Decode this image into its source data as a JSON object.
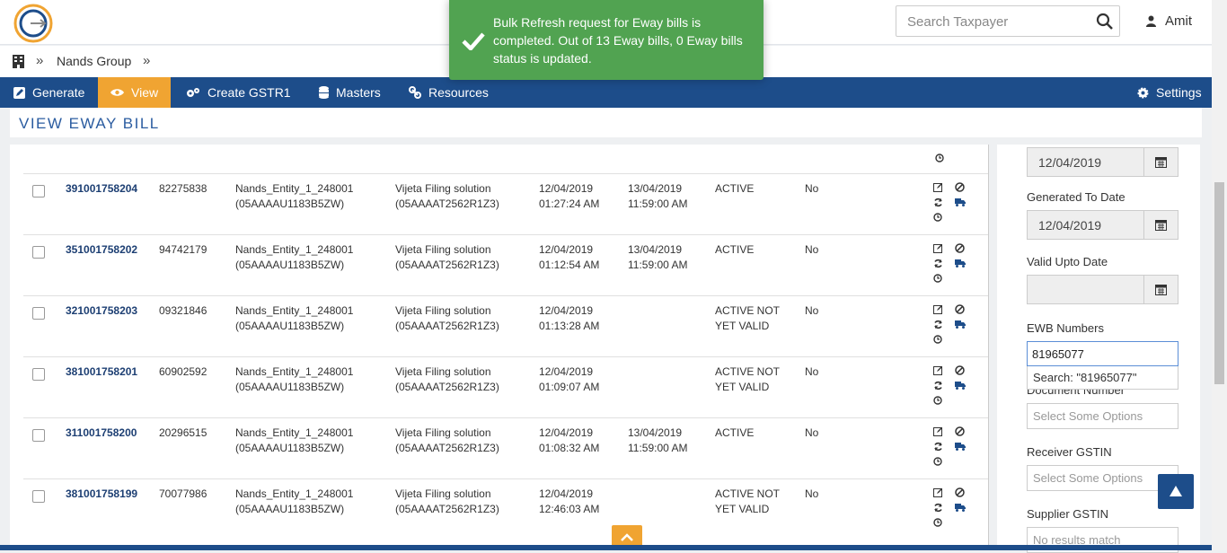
{
  "header": {
    "search_placeholder": "Search Taxpayer",
    "user_name": "Amit"
  },
  "breadcrumb": {
    "group": "Nands Group"
  },
  "nav": {
    "generate": "Generate",
    "view": "View",
    "create_gstr1": "Create GSTR1",
    "masters": "Masters",
    "resources": "Resources",
    "settings": "Settings"
  },
  "page_title": "VIEW EWAY BILL",
  "toast": {
    "message": "Bulk Refresh request for Eway bills is completed. Out of 13 Eway bills, 0 Eway bills status is updated."
  },
  "rows": [
    {
      "ewb": "391001758204",
      "doc": "82275838",
      "from": "Nands_Entity_1_248001",
      "from_gstin": "(05AAAAU1183B5ZW)",
      "to": "Vijeta Filing solution",
      "to_gstin": "(05AAAAT2562R1Z3)",
      "gen_date": "12/04/2019",
      "gen_time": "01:27:24 AM",
      "valid_date": "13/04/2019",
      "valid_time": "11:59:00 AM",
      "status1": "ACTIVE",
      "status2": "",
      "flag": "No"
    },
    {
      "ewb": "351001758202",
      "doc": "94742179",
      "from": "Nands_Entity_1_248001",
      "from_gstin": "(05AAAAU1183B5ZW)",
      "to": "Vijeta Filing solution",
      "to_gstin": "(05AAAAT2562R1Z3)",
      "gen_date": "12/04/2019",
      "gen_time": "01:12:54 AM",
      "valid_date": "13/04/2019",
      "valid_time": "11:59:00 AM",
      "status1": "ACTIVE",
      "status2": "",
      "flag": "No"
    },
    {
      "ewb": "321001758203",
      "doc": "09321846",
      "from": "Nands_Entity_1_248001",
      "from_gstin": "(05AAAAU1183B5ZW)",
      "to": "Vijeta Filing solution",
      "to_gstin": "(05AAAAT2562R1Z3)",
      "gen_date": "12/04/2019",
      "gen_time": "01:13:28 AM",
      "valid_date": "",
      "valid_time": "",
      "status1": "ACTIVE NOT",
      "status2": "YET VALID",
      "flag": "No"
    },
    {
      "ewb": "381001758201",
      "doc": "60902592",
      "from": "Nands_Entity_1_248001",
      "from_gstin": "(05AAAAU1183B5ZW)",
      "to": "Vijeta Filing solution",
      "to_gstin": "(05AAAAT2562R1Z3)",
      "gen_date": "12/04/2019",
      "gen_time": "01:09:07 AM",
      "valid_date": "",
      "valid_time": "",
      "status1": "ACTIVE NOT",
      "status2": "YET VALID",
      "flag": "No"
    },
    {
      "ewb": "311001758200",
      "doc": "20296515",
      "from": "Nands_Entity_1_248001",
      "from_gstin": "(05AAAAU1183B5ZW)",
      "to": "Vijeta Filing solution",
      "to_gstin": "(05AAAAT2562R1Z3)",
      "gen_date": "12/04/2019",
      "gen_time": "01:08:32 AM",
      "valid_date": "13/04/2019",
      "valid_time": "11:59:00 AM",
      "status1": "ACTIVE",
      "status2": "",
      "flag": "No"
    },
    {
      "ewb": "381001758199",
      "doc": "70077986",
      "from": "Nands_Entity_1_248001",
      "from_gstin": "(05AAAAU1183B5ZW)",
      "to": "Vijeta Filing solution",
      "to_gstin": "(05AAAAT2562R1Z3)",
      "gen_date": "12/04/2019",
      "gen_time": "12:46:03 AM",
      "valid_date": "",
      "valid_time": "",
      "status1": "ACTIVE NOT",
      "status2": "YET VALID",
      "flag": "No"
    }
  ],
  "filters": {
    "generated_from_value": "12/04/2019",
    "generated_to_label": "Generated To Date",
    "generated_to_value": "12/04/2019",
    "valid_upto_label": "Valid Upto Date",
    "valid_upto_value": "",
    "ewb_numbers_label": "EWB Numbers",
    "ewb_numbers_value": "81965077",
    "ewb_search_suggestion": "Search: \"81965077\"",
    "document_number_label": "Document Number",
    "document_number_placeholder": "Select Some Options",
    "receiver_gstin_label": "Receiver GSTIN",
    "receiver_gstin_placeholder": "Select Some Options",
    "supplier_gstin_label": "Supplier GSTIN",
    "supplier_gstin_placeholder": "No results match"
  }
}
